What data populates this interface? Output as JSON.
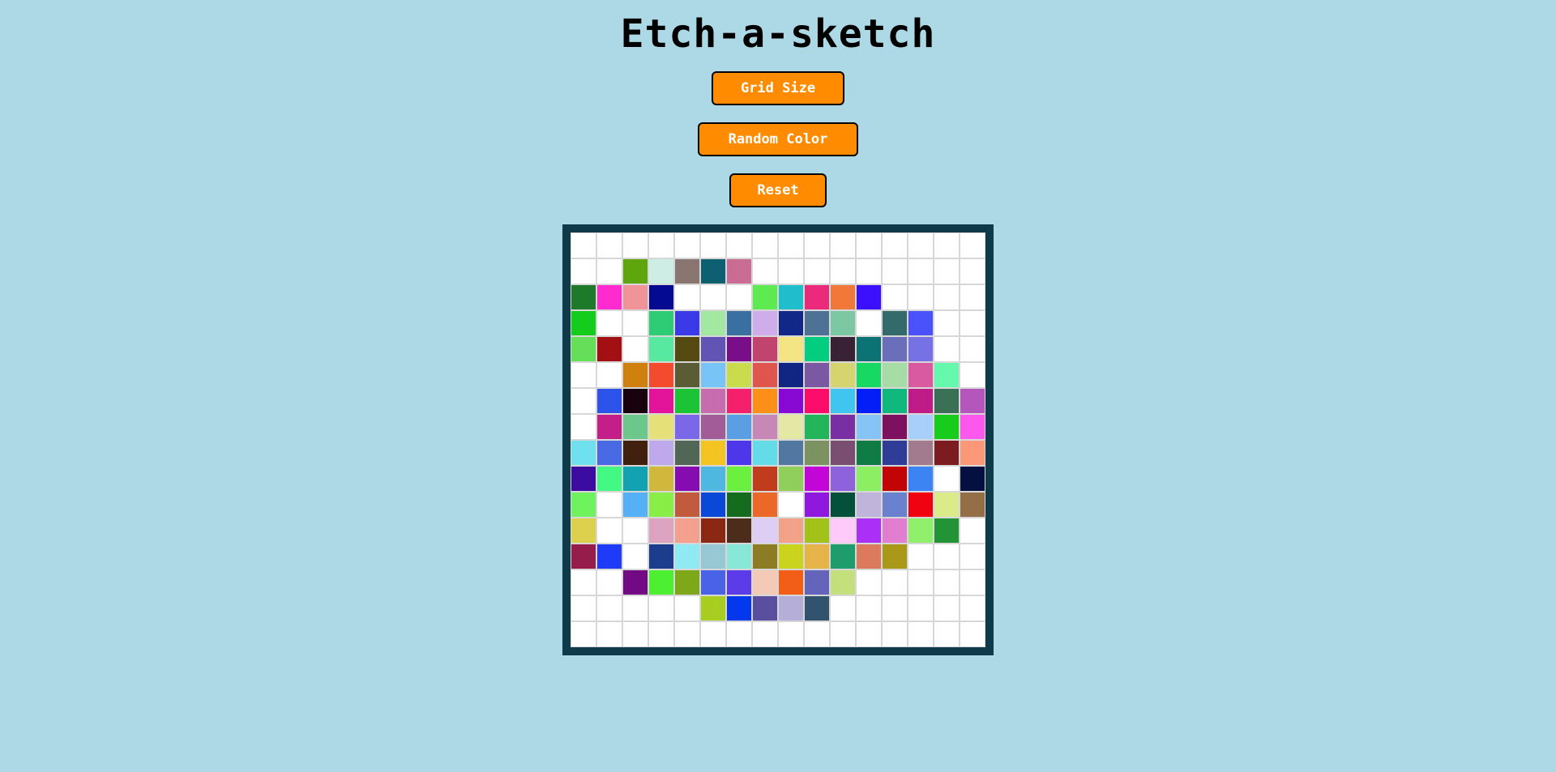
{
  "title": "Etch-a-sketch",
  "buttons": {
    "grid_size": "Grid Size",
    "random_color": "Random Color",
    "reset": "Reset"
  },
  "colors": {
    "background": "#add8e6",
    "button": "#ff8c00",
    "board_border": "#0e3a49",
    "empty_cell": "#ffffff"
  },
  "grid": {
    "size": 16,
    "cells": [
      [
        "",
        "",
        "",
        "",
        "",
        "",
        "",
        "",
        "",
        "",
        "",
        "",
        "",
        "",
        "",
        ""
      ],
      [
        "",
        "",
        "#5fa50e",
        "#cdeee5",
        "#8a7670",
        "#0d6070",
        "#cb6c94",
        "",
        "",
        "",
        "",
        "",
        "",
        "",
        "",
        ""
      ],
      [
        "#1c7a2a",
        "#ff2ad0",
        "#f0949a",
        "#050b90",
        "",
        "",
        "",
        "#5eeb52",
        "#20bdcc",
        "#ec2a7c",
        "#f07838",
        "#3d0fff",
        "",
        "",
        "",
        ""
      ],
      [
        "#13cc1b",
        "",
        "",
        "#2ecc74",
        "#3a3ae8",
        "#a2e8a2",
        "#3a6fa2",
        "#cfacea",
        "#122888",
        "#4e7294",
        "#7cc8a2",
        "",
        "#336b6a",
        "#4952fb",
        "",
        ""
      ],
      [
        "#65de58",
        "#a30f12",
        "",
        "#58e8a0",
        "#544a12",
        "#6154b4",
        "#7a0d88",
        "#c0446e",
        "#f4e484",
        "#03ce80",
        "#3a2236",
        "#0c7274",
        "#6b6fba",
        "#7672e6",
        "",
        ""
      ],
      [
        "",
        "",
        "#d0800c",
        "#f44b2e",
        "#5a5c34",
        "#78c4f6",
        "#cadc4c",
        "#e0564e",
        "#102682",
        "#7a58a2",
        "#d6d46e",
        "#18d864",
        "#a8dca6",
        "#da5aa0",
        "#66f8ac",
        ""
      ],
      [
        "",
        "#2d54ea",
        "#18020e",
        "#e4149a",
        "#1bc434",
        "#c86cb0",
        "#f4206c",
        "#fc9018",
        "#8808d4",
        "#fe0c6a",
        "#40c4f0",
        "#041ef8",
        "#10b87e",
        "#c01c88",
        "#3a7054",
        "#b456bc"
      ],
      [
        "",
        "#c41e88",
        "#6bc88a",
        "#e6e07a",
        "#7a68e8",
        "#a25c98",
        "#5a9ee4",
        "#c888b6",
        "#e4e8a2",
        "#24b45a",
        "#7a2ea4",
        "#86c4f6",
        "#7e1060",
        "#a8cefa",
        "#18cc1c",
        "#fc58ee"
      ],
      [
        "#6ee0ee",
        "#496ae2",
        "#42200e",
        "#c0a8ec",
        "#526656",
        "#f4c420",
        "#4c38ea",
        "#64dce8",
        "#5278a2",
        "#7c9260",
        "#7a4e70",
        "#0e7c44",
        "#2f3c98",
        "#a27c8e",
        "#7c1c20",
        "#fa9878"
      ],
      [
        "#3c0ca0",
        "#44f884",
        "#12a2b2",
        "#d0b83e",
        "#860cb2",
        "#50b8e0",
        "#6cf040",
        "#c03c1c",
        "#90d05a",
        "#c206d8",
        "#8e62da",
        "#8cee62",
        "#c20404",
        "#3c84f4",
        "",
        "#061040"
      ],
      [
        "#6ef25e",
        "",
        "#56b0f6",
        "#8aee48",
        "#c25a3e",
        "#0c48d8",
        "#166c1e",
        "#ec6828",
        "",
        "#9018de",
        "#04503a",
        "#c0b4da",
        "#6a82ce",
        "#f0020e",
        "#dceb8a",
        "#946e46"
      ],
      [
        "#dcd04c",
        "",
        "",
        "#dca4c0",
        "#f4a08e",
        "#8a2814",
        "#4c2c1a",
        "#decef6",
        "#f2a288",
        "#a2c21a",
        "#fecafa",
        "#ac2ff6",
        "#e27ed0",
        "#90f06c",
        "#229436",
        ""
      ],
      [
        "#961c4c",
        "#1e3cf8",
        "",
        "#1c3c8e",
        "#90eaf4",
        "#98c8d4",
        "#88e8d8",
        "#8e7c24",
        "#cad41c",
        "#e6b448",
        "#1e9c6c",
        "#dc7a5e",
        "#aa9818",
        "",
        "",
        ""
      ],
      [
        "",
        "",
        "#720a84",
        "#4eee30",
        "#7ea81a",
        "#4a62e6",
        "#5c3ce8",
        "#f2cab6",
        "#f25e16",
        "#6464ba",
        "#c4e07c",
        "",
        "",
        "",
        "",
        ""
      ],
      [
        "",
        "",
        "",
        "",
        "",
        "#a8ce22",
        "#0438ec",
        "#5a4ea0",
        "#b4aed8",
        "#31536e",
        "",
        "",
        "",
        "",
        "",
        ""
      ],
      [
        "",
        "",
        "",
        "",
        "",
        "",
        "",
        "",
        "",
        "",
        "",
        "",
        "",
        "",
        "",
        ""
      ]
    ]
  }
}
